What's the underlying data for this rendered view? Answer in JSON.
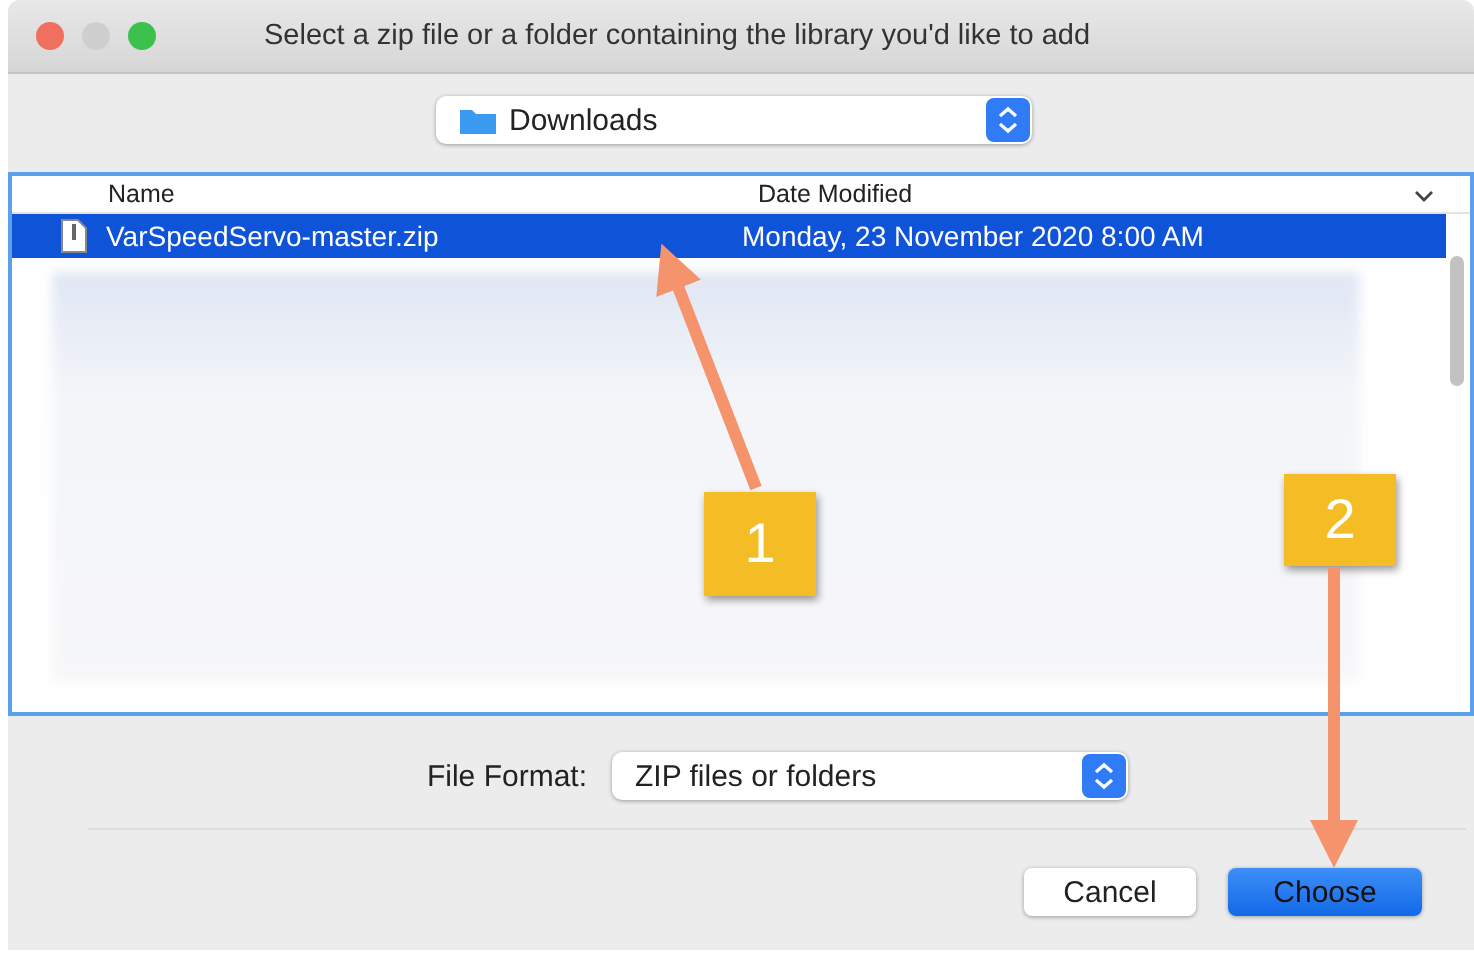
{
  "window": {
    "title": "Select a zip file or a folder containing the library you'd like to add"
  },
  "location_popup": {
    "value": "Downloads"
  },
  "file_list": {
    "columns": [
      "Name",
      "Date Modified"
    ],
    "rows": [
      {
        "name": "VarSpeedServo-master.zip",
        "date_modified": "Monday, 23 November 2020 8:00 AM",
        "selected": true
      }
    ]
  },
  "file_format": {
    "label": "File Format:",
    "value": "ZIP files or folders"
  },
  "buttons": [
    {
      "label": "Cancel",
      "kind": "normal"
    },
    {
      "label": "Choose",
      "kind": "default"
    }
  ],
  "annotations": [
    {
      "label": "1"
    },
    {
      "label": "2"
    }
  ]
}
